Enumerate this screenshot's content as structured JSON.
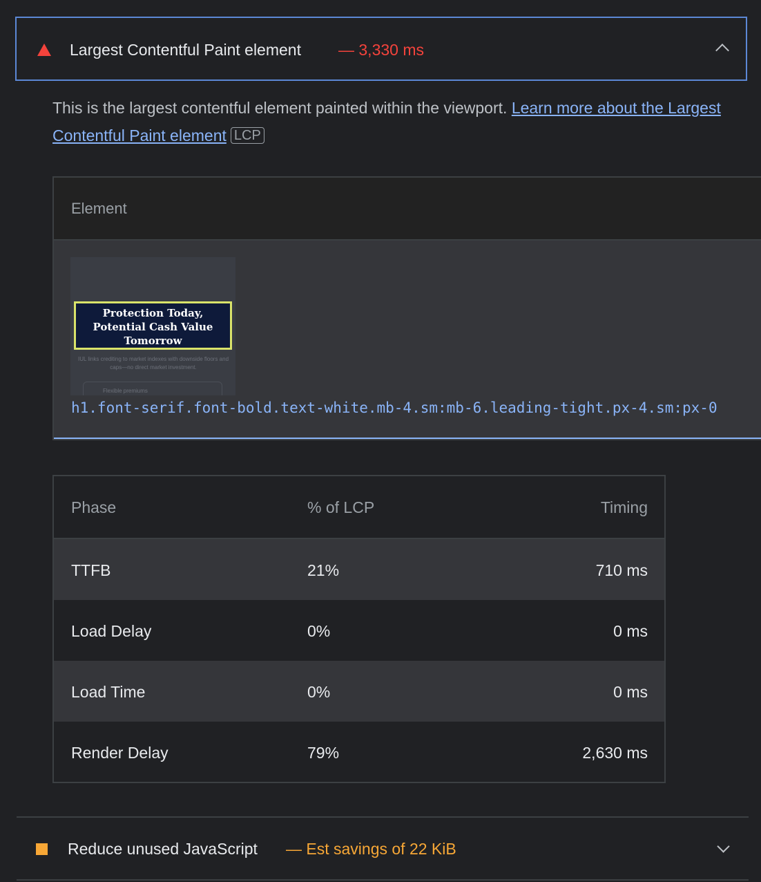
{
  "lcp_audit": {
    "title": "Largest Contentful Paint element",
    "separator_value": "— 3,330 ms",
    "status": "fail",
    "status_color": "#f4433c",
    "expand_icon": "chevron-up-icon",
    "description": "This is the largest contentful element painted within the viewport.",
    "link_text": "Learn more about the Largest Contentful Paint element",
    "badge": "LCP"
  },
  "element_table": {
    "header": "Element",
    "thumbnail": {
      "heading": "Protection Today, Potential Cash Value Tomorrow",
      "subtext": "IUL links crediting to market indexes with downside floors and caps—no direct market investment.",
      "pill": "Flexible premiums"
    },
    "selector": "h1.font-serif.font-bold.text-white.mb-4.sm:mb-6.leading-tight.px-4.sm:px-0"
  },
  "phase_table": {
    "headers": [
      "Phase",
      "% of LCP",
      "Timing"
    ],
    "rows": [
      {
        "phase": "TTFB",
        "pct": "21%",
        "timing": "710 ms"
      },
      {
        "phase": "Load Delay",
        "pct": "0%",
        "timing": "0 ms"
      },
      {
        "phase": "Load Time",
        "pct": "0%",
        "timing": "0 ms"
      },
      {
        "phase": "Render Delay",
        "pct": "79%",
        "timing": "2,630 ms"
      }
    ]
  },
  "next_audit": {
    "title": "Reduce unused JavaScript",
    "separator_value": "— Est savings of 22 KiB",
    "status": "average",
    "status_color": "#f7a736",
    "expand_icon": "chevron-down-icon"
  }
}
